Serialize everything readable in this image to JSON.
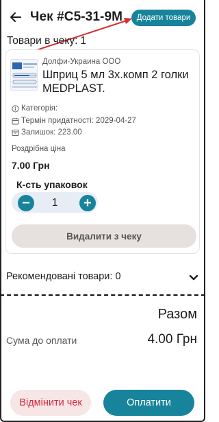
{
  "header": {
    "back_icon": "arrow-left-icon",
    "title": "Чек #C5-31-9M",
    "add_button": "Додати товари"
  },
  "cart": {
    "items_label": "Товари в чеку:",
    "items_count": "1"
  },
  "product": {
    "supplier": "Долфи-Украина ООО",
    "name": "Шприц 5 мл 3х.комп 2 голки MEDPLAST.",
    "category_label": "Категорія:",
    "expiry": "Термін придатності: 2029-04-27",
    "stock": "Залишок: 223.00",
    "price_label": "Роздрібна ціна",
    "price": "7.00 Грн",
    "qty_label": "К-сть упаковок",
    "qty_value": "1",
    "minus_symbol": "−",
    "plus_symbol": "+",
    "remove_button": "Видалити з чеку"
  },
  "recommended": {
    "label": "Рекомендовані товари: 0",
    "icon": "chevron-down-icon"
  },
  "totals": {
    "heading": "Разом",
    "sum_label": "Сума до оплати",
    "sum_value": "4.00 Грн"
  },
  "actions": {
    "cancel_button": "Відмінити чек",
    "pay_button": "Оплатити"
  },
  "colors": {
    "accent": "#17849b",
    "danger": "#d7263d",
    "annotation_arrow": "#d32f2f"
  }
}
